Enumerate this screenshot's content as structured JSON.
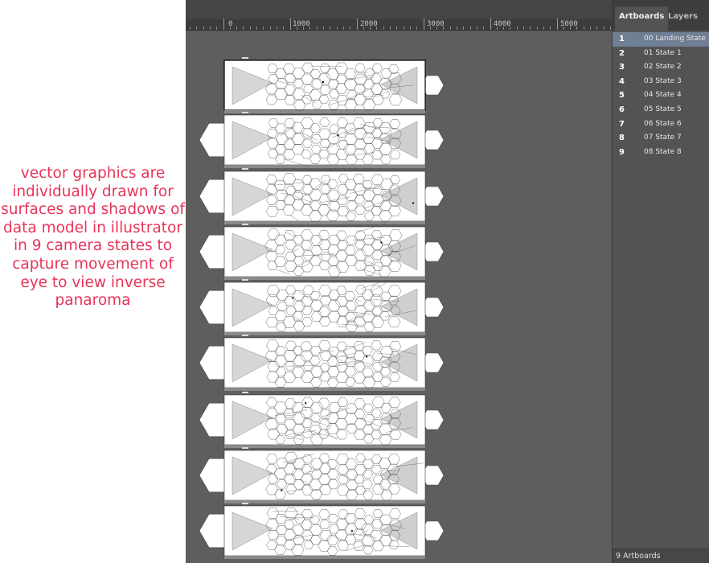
{
  "caption": "vector graphics are individually drawn for surfaces and shadows of data model in illustrator in 9 camera states to capture movement of eye to view inverse panaroma",
  "ruler": {
    "labels": [
      "0",
      "1000",
      "2000",
      "3000",
      "4000",
      "5000"
    ]
  },
  "panel": {
    "tabs": [
      "Artboards",
      "Layers"
    ],
    "artboards": [
      {
        "num": "1",
        "name": "00 Landing State"
      },
      {
        "num": "2",
        "name": "01 State 1"
      },
      {
        "num": "3",
        "name": "02 State 2"
      },
      {
        "num": "4",
        "name": "03 State 3"
      },
      {
        "num": "5",
        "name": "04 State 4"
      },
      {
        "num": "6",
        "name": "05 State 5"
      },
      {
        "num": "7",
        "name": "06 State 6"
      },
      {
        "num": "8",
        "name": "07 State 7"
      },
      {
        "num": "9",
        "name": "08 State 8"
      }
    ],
    "selected_index": 0,
    "footer": "9 Artboards"
  },
  "colors": {
    "caption": "#e8345a",
    "canvas": "#5e5e5e",
    "selection": "#6f7f94"
  }
}
